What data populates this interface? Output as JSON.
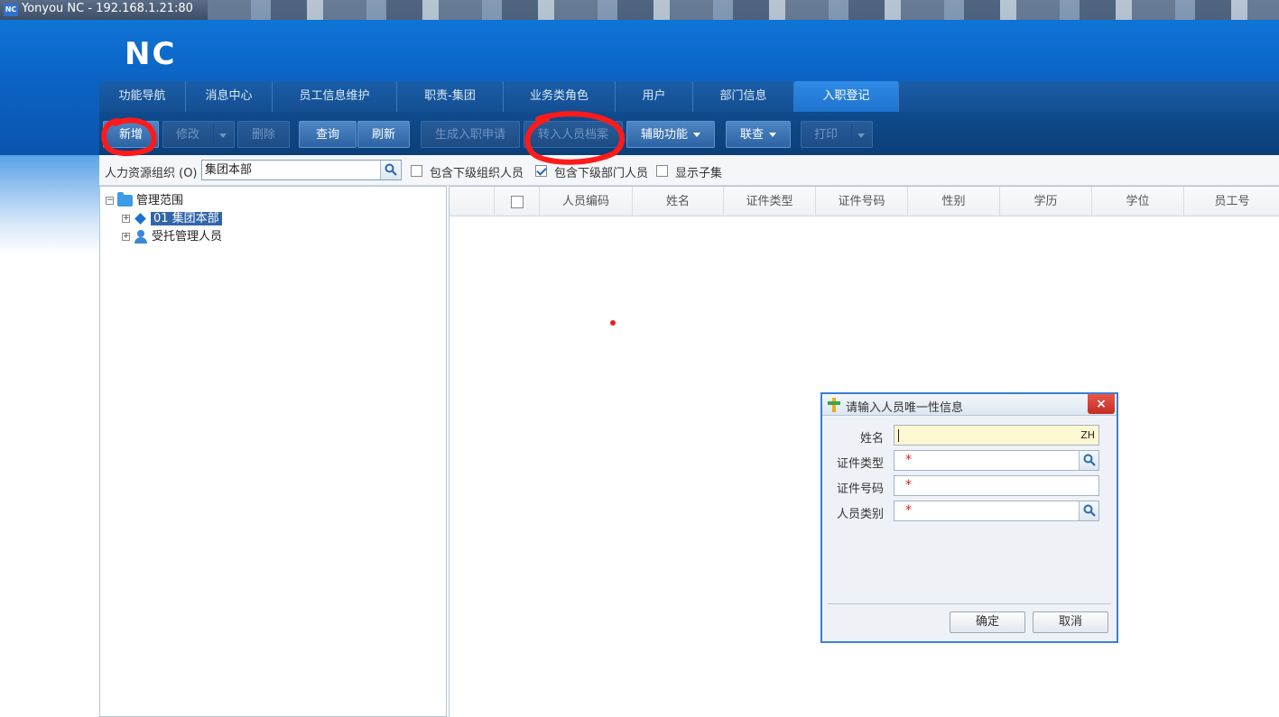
{
  "window": {
    "title": "Yonyou NC - 192.168.1.21:80",
    "icon": "NC"
  },
  "brand": {
    "logo": "NC"
  },
  "tabs": [
    {
      "label": "功能导航"
    },
    {
      "label": "消息中心"
    },
    {
      "label": "员工信息维护"
    },
    {
      "label": "职责-集团"
    },
    {
      "label": "业务类角色"
    },
    {
      "label": "用户"
    },
    {
      "label": "部门信息"
    },
    {
      "label": "入职登记",
      "active": true
    }
  ],
  "toolbar": {
    "new": "新增",
    "edit": "修改",
    "delete": "删除",
    "query": "查询",
    "refresh": "刷新",
    "generate_request": "生成入职申请",
    "transfer_archive": "转入人员档案",
    "assist": "辅助功能",
    "linked_query": "联查",
    "print": "打印"
  },
  "filter": {
    "org_label": "人力资源组织 (O)",
    "org_value": "集团本部",
    "include_sub_org": "包含下级组织人员",
    "include_sub_org_checked": false,
    "include_sub_dept": "包含下级部门人员",
    "include_sub_dept_checked": true,
    "show_subset": "显示子集",
    "show_subset_checked": false
  },
  "tree": {
    "root": "管理范围",
    "children": [
      {
        "label": "01 集团本部",
        "selected": true
      },
      {
        "label": "受托管理人员"
      }
    ]
  },
  "grid": {
    "columns": [
      "人员编码",
      "姓名",
      "证件类型",
      "证件号码",
      "性别",
      "学历",
      "学位",
      "员工号"
    ]
  },
  "dialog": {
    "title": "请输入人员唯一性信息",
    "close": "×",
    "fields": [
      {
        "label": "姓名",
        "value": "ZH",
        "required": false
      },
      {
        "label": "证件类型",
        "value": "",
        "required": true
      },
      {
        "label": "证件号码",
        "value": "",
        "required": true
      },
      {
        "label": "人员类别",
        "value": "",
        "required": true
      }
    ],
    "required_mark": "*",
    "ok": "确定",
    "cancel": "取消"
  },
  "colors": {
    "header_blue": "#0b63c4",
    "toolbar_blue": "#0f4c8e",
    "active_tab": "#2f8be6",
    "required_red": "#e42218",
    "annotation_red": "#ff1a1a"
  }
}
